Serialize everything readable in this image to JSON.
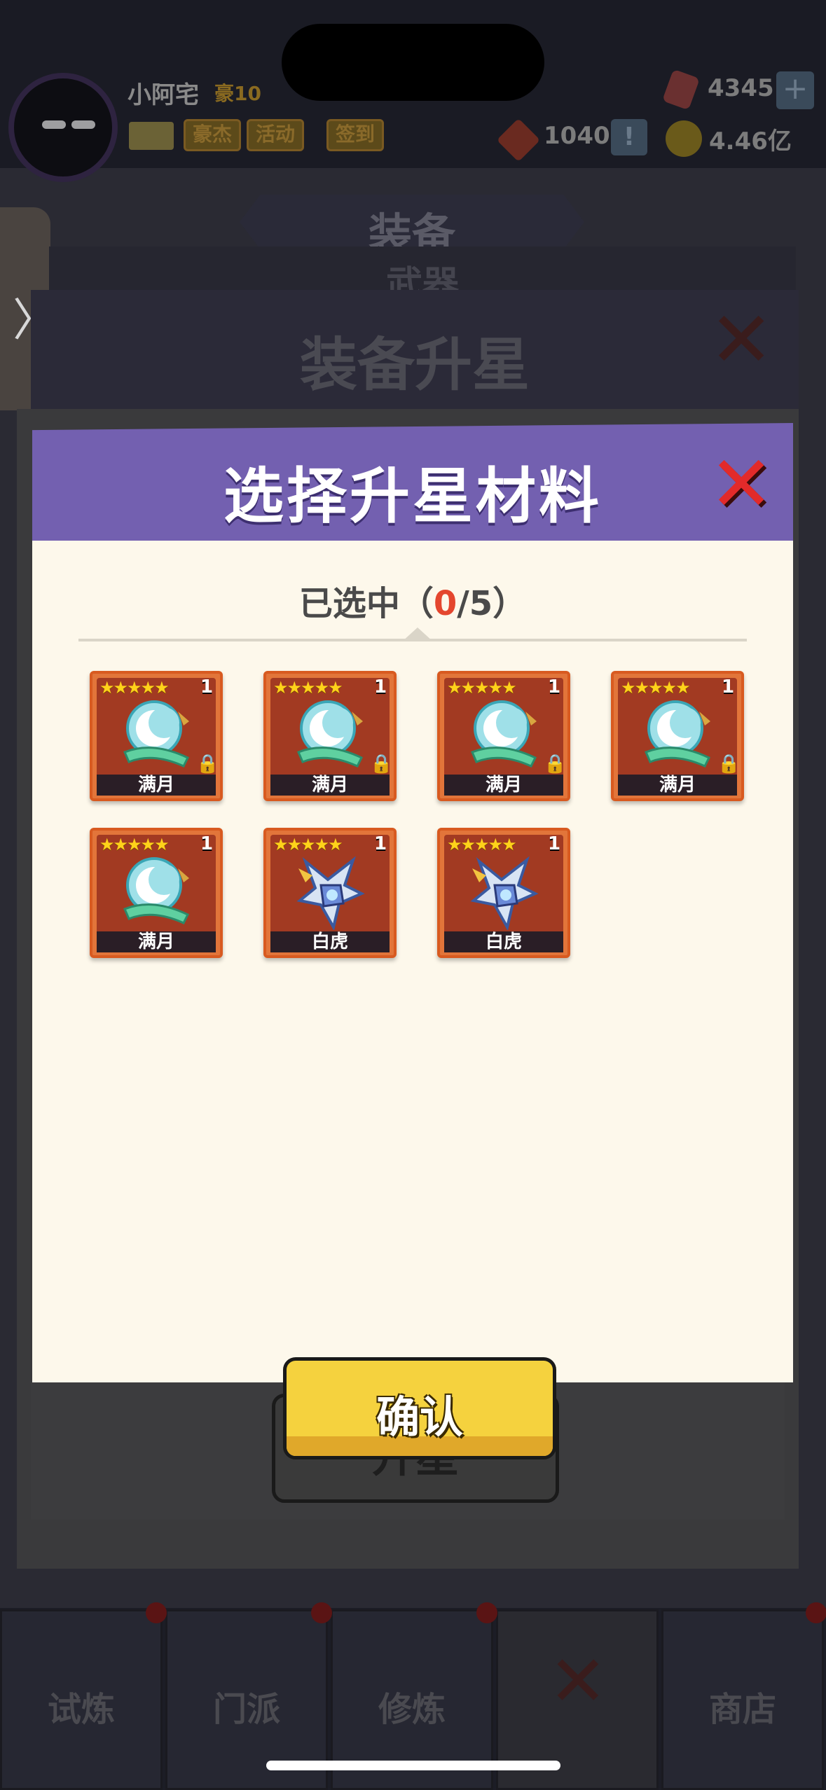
{
  "header": {
    "username": "小阿宅",
    "vip_level": "豪10",
    "tags": [
      "豪杰",
      "活动",
      "签到"
    ],
    "resources": {
      "gems": "4345",
      "tickets": "1040",
      "gold": "4.46亿"
    }
  },
  "background": {
    "section_banner": "装备",
    "section_subtitle": "武器",
    "panel_title": "装备升星",
    "upstar_button": "升星"
  },
  "bottom_nav": {
    "items": [
      {
        "label": "试炼"
      },
      {
        "label": "门派"
      },
      {
        "label": "修炼"
      },
      {
        "label": ""
      },
      {
        "label": "商店"
      }
    ]
  },
  "modal": {
    "title": "选择升星材料",
    "selected_prefix": "已选中（",
    "selected_count": "0",
    "selected_sep": "/",
    "selected_max": "5",
    "selected_suffix": "）",
    "confirm_label": "确认",
    "items": [
      {
        "name": "满月",
        "stars": "★★★★★",
        "level": "1",
        "icon": "moon-weapon-icon",
        "locked": true
      },
      {
        "name": "满月",
        "stars": "★★★★★",
        "level": "1",
        "icon": "moon-weapon-icon",
        "locked": true
      },
      {
        "name": "满月",
        "stars": "★★★★★",
        "level": "1",
        "icon": "moon-weapon-icon",
        "locked": true
      },
      {
        "name": "满月",
        "stars": "★★★★★",
        "level": "1",
        "icon": "moon-weapon-icon",
        "locked": true
      },
      {
        "name": "满月",
        "stars": "★★★★★",
        "level": "1",
        "icon": "moon-weapon-icon",
        "locked": false
      },
      {
        "name": "白虎",
        "stars": "★★★★★",
        "level": "1",
        "icon": "white-tiger-gauntlet-icon",
        "locked": false
      },
      {
        "name": "白虎",
        "stars": "★★★★★",
        "level": "1",
        "icon": "white-tiger-gauntlet-icon",
        "locked": false
      }
    ]
  },
  "colors": {
    "modal_header": "#7360b0",
    "modal_body": "#fdf8eb",
    "selected_count": "#e4462e",
    "confirm_button": "#f5d23e",
    "card_frame": "#e2753a",
    "close_x": "#e22a2a"
  }
}
